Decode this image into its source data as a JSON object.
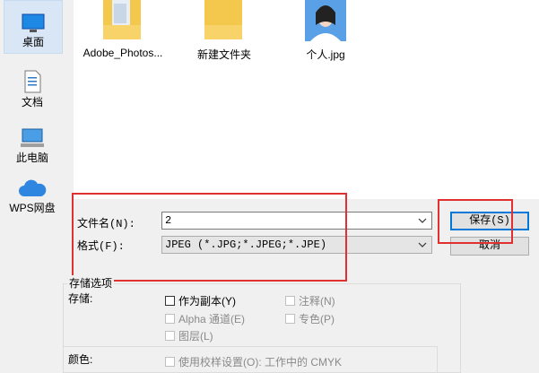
{
  "sidebar": {
    "items": [
      {
        "label": "桌面",
        "icon": "desktop-icon"
      },
      {
        "label": "文档",
        "icon": "document-icon"
      },
      {
        "label": "此电脑",
        "icon": "computer-icon"
      },
      {
        "label": "WPS网盘",
        "icon": "cloud-icon"
      }
    ]
  },
  "files": [
    {
      "name": "Adobe_Photos...",
      "icon": "folder-icon"
    },
    {
      "name": "新建文件夹",
      "icon": "folder-icon"
    },
    {
      "name": "个人.jpg",
      "icon": "image-thumbnail"
    }
  ],
  "form": {
    "filename_label": "文件名(N):",
    "filename_value": "2",
    "format_label": "格式(F):",
    "format_value": "JPEG (*.JPG;*.JPEG;*.JPE)"
  },
  "buttons": {
    "save": "保存(S)",
    "cancel": "取消"
  },
  "storage_options": {
    "group_title": "存储选项",
    "storage_label": "存储:",
    "as_copy": "作为副本(Y)",
    "notes": "注释(N)",
    "alpha": "Alpha 通道(E)",
    "spot": "专色(P)",
    "layers": "图层(L)"
  },
  "color": {
    "label": "颜色:",
    "use_proof": "使用校样设置(O): 工作中的 CMYK"
  },
  "colors": {
    "highlight_box": "#e03030",
    "selected_bg": "#d9e6f5",
    "folder": "#f4c84c"
  }
}
